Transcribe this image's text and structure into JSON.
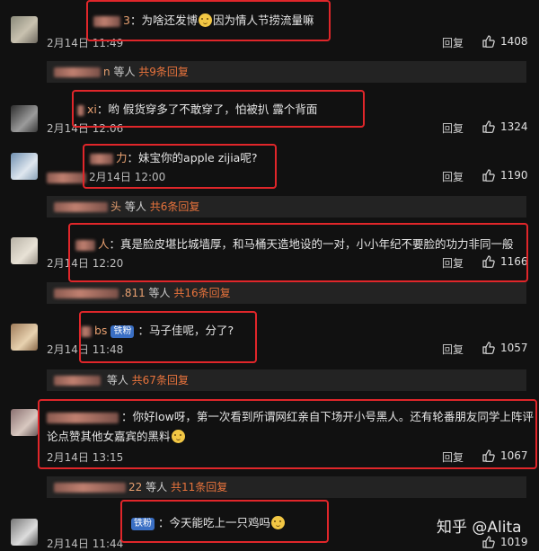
{
  "comments": [
    {
      "name": "3",
      "text": "为啥还发博",
      "text2": "因为情人节捞流量嘛",
      "date": "2月14日 11:49",
      "reply": "回复",
      "likes": "1408"
    },
    {
      "name": "xi",
      "text": "哟 假货穿多了不敢穿了，怕被扒 露个背面",
      "date": "2月14日 12:06",
      "reply": "回复",
      "likes": "1324"
    },
    {
      "name": "力",
      "text": "妹宝你的apple zijia呢?",
      "date": "2月14日 12:00",
      "reply": "回复",
      "likes": "1190"
    },
    {
      "name": "人",
      "text": "真是脸皮堪比城墙厚，和马桶天造地设的一对，小小年纪不要脸的功力非同一般",
      "date": "2月14日 12:20",
      "reply": "回复",
      "likes": "1166"
    },
    {
      "name": "bs",
      "badge": "铁粉",
      "text": "马子佳呢，分了?",
      "date": "2月14日 11:48",
      "reply": "回复",
      "likes": "1057"
    },
    {
      "name": "",
      "text": "你好low呀，第一次看到所谓网红亲自下场开小号黑人。还有轮番朋友同学上阵评",
      "text_line2": "论点赞其他女嘉宾的黑料",
      "date": "2月14日 13:15",
      "reply": "回复",
      "likes": "1067"
    },
    {
      "name": "",
      "badge": "铁粉",
      "text": "今天能吃上一只鸡吗",
      "date": "2月14日 11:44",
      "reply": "回复",
      "likes": "1019"
    }
  ],
  "summaries": [
    {
      "name": "n",
      "suffix": "等人",
      "count": "共9条回复"
    },
    {
      "name": "头",
      "suffix": "等人",
      "count": "共6条回复"
    },
    {
      "name": ".811",
      "suffix": "等人",
      "count": "共16条回复"
    },
    {
      "name": "",
      "suffix": "等人",
      "count": "共67条回复"
    },
    {
      "name": "22",
      "suffix": "等人",
      "count": "共11条回复"
    }
  ],
  "watermark": "知乎 @Alita"
}
